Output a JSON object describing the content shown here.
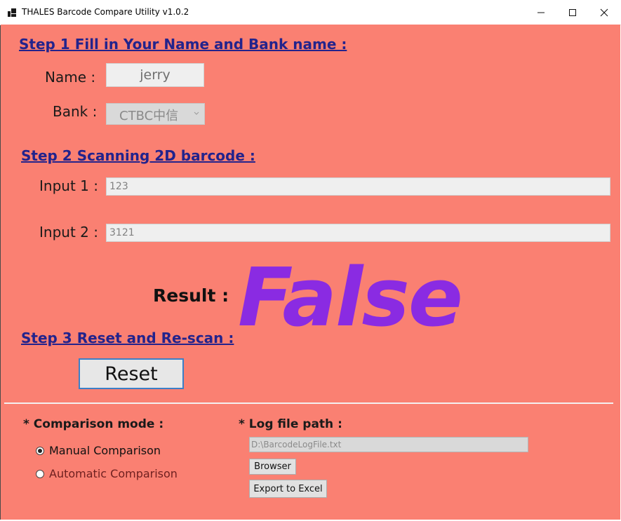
{
  "window": {
    "title": "THALES Barcode Compare Utility v1.0.2",
    "minimize_icon": "minimize-icon",
    "maximize_icon": "maximize-icon",
    "close_icon": "close-icon"
  },
  "step1": {
    "heading": "Step 1   Fill in Your Name and Bank name :",
    "name_label": "Name :",
    "name_value": "jerry",
    "bank_label": "Bank :",
    "bank_value": "CTBC中信"
  },
  "step2": {
    "heading": "Step 2   Scanning 2D barcode :",
    "input1_label": "Input 1 :",
    "input1_value": "123",
    "input2_label": "Input 2 :",
    "input2_value": "3121"
  },
  "result": {
    "label": "Result :",
    "value": "False",
    "value_color": "#8a2be2"
  },
  "step3": {
    "heading": "Step 3   Reset and Re-scan :",
    "reset_label": "Reset"
  },
  "comparison": {
    "title": "* Comparison mode :",
    "options": [
      {
        "label": "Manual Comparison",
        "checked": true
      },
      {
        "label": "Automatic Comparison",
        "checked": false
      }
    ]
  },
  "log": {
    "title": "* Log file path :",
    "path": "D:\\BarcodeLogFile.txt",
    "browse_label": "Browser",
    "export_label": "Export to Excel"
  },
  "colors": {
    "background": "#fa8072",
    "heading": "#23238c",
    "reset_border": "#3c7fc7"
  }
}
